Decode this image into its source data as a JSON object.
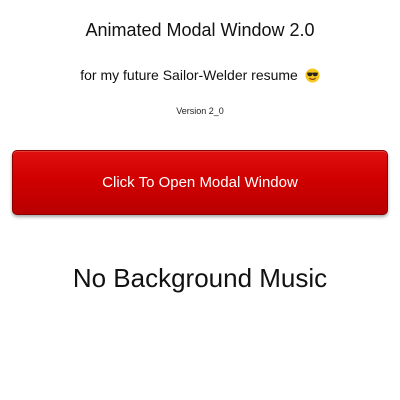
{
  "header": {
    "title": "Animated Modal Window 2.0",
    "subtitle": "for my future Sailor-Welder resume",
    "subtitle_icon": "smiling-face-with-sunglasses-icon",
    "version": "Version 2_0"
  },
  "main": {
    "open_button_label": "Click To Open Modal Window",
    "music_status": "No Background Music"
  },
  "colors": {
    "button": "#d00000",
    "button_text": "#ffffff",
    "background": "#ffffff",
    "text": "#111111"
  }
}
